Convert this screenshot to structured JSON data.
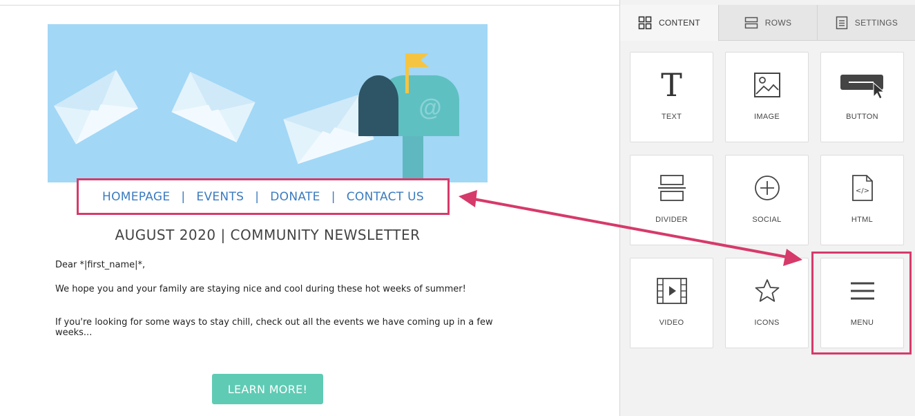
{
  "newsletter": {
    "menu": {
      "items": [
        "HOMEPAGE",
        "EVENTS",
        "DONATE",
        "CONTACT US"
      ],
      "separator": "|"
    },
    "title": "AUGUST 2020 | COMMUNITY NEWSLETTER",
    "greeting": "Dear *|first_name|*,",
    "paragraph1": "We hope you and your family are staying nice and cool during these hot weeks of summer!",
    "paragraph2": "If you're looking for some ways to stay chill, check out all the events we have coming up in a few weeks...",
    "cta_label": "LEARN MORE!",
    "banner_mailbox_text": "@"
  },
  "panel": {
    "tabs": [
      {
        "label": "CONTENT",
        "icon": "grid-icon",
        "active": true
      },
      {
        "label": "ROWS",
        "icon": "rows-icon",
        "active": false
      },
      {
        "label": "SETTINGS",
        "icon": "settings-doc-icon",
        "active": false
      }
    ],
    "blocks": [
      {
        "label": "TEXT",
        "icon": "text-icon"
      },
      {
        "label": "IMAGE",
        "icon": "image-icon"
      },
      {
        "label": "BUTTON",
        "icon": "button-icon"
      },
      {
        "label": "DIVIDER",
        "icon": "divider-icon"
      },
      {
        "label": "SOCIAL",
        "icon": "social-icon"
      },
      {
        "label": "HTML",
        "icon": "html-icon"
      },
      {
        "label": "VIDEO",
        "icon": "video-icon"
      },
      {
        "label": "ICONS",
        "icon": "star-icon"
      },
      {
        "label": "MENU",
        "icon": "menu-icon"
      }
    ],
    "text_icon_glyph": "T",
    "html_icon_glyph": "</>"
  },
  "colors": {
    "highlight": "#d63a6a",
    "menu_link": "#3a7bbf",
    "cta": "#5fcbb4",
    "banner_bg": "#a2d7f6"
  }
}
